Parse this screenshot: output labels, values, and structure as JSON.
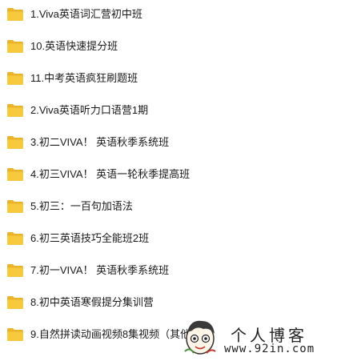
{
  "folders": [
    {
      "name": "1.Viva英语词汇营初中班",
      "icon": "folder-icon"
    },
    {
      "name": "10.英语快速提分班",
      "icon": "folder-icon"
    },
    {
      "name": "11.中考英语疯狂刷题班",
      "icon": "folder-icon"
    },
    {
      "name": "2.Viva英语听力口语营1期",
      "icon": "folder-icon"
    },
    {
      "name": "3.初二VIVA！ 英语秋季系统班",
      "icon": "folder-icon"
    },
    {
      "name": "4.初三VIVA！ 英语一轮秋季提高班",
      "icon": "folder-icon"
    },
    {
      "name": "5.初三：一百句加语法",
      "icon": "folder-icon"
    },
    {
      "name": "6.初三英语技巧全能班2班",
      "icon": "folder-icon"
    },
    {
      "name": "7.初一VIVA！ 英语秋季系统班",
      "icon": "folder-icon"
    },
    {
      "name": "8.初中英语寒假提分集训营",
      "icon": "folder-icon"
    },
    {
      "name": "9.自然拼读动画视频8集视频（其他",
      "icon": "folder-icon"
    }
  ],
  "watermark": {
    "title": "个人博客",
    "url": "www.92in.com"
  },
  "colors": {
    "folder_body": "#F8C83E",
    "folder_tab": "#E9B32A",
    "text": "#1a1a1a"
  }
}
